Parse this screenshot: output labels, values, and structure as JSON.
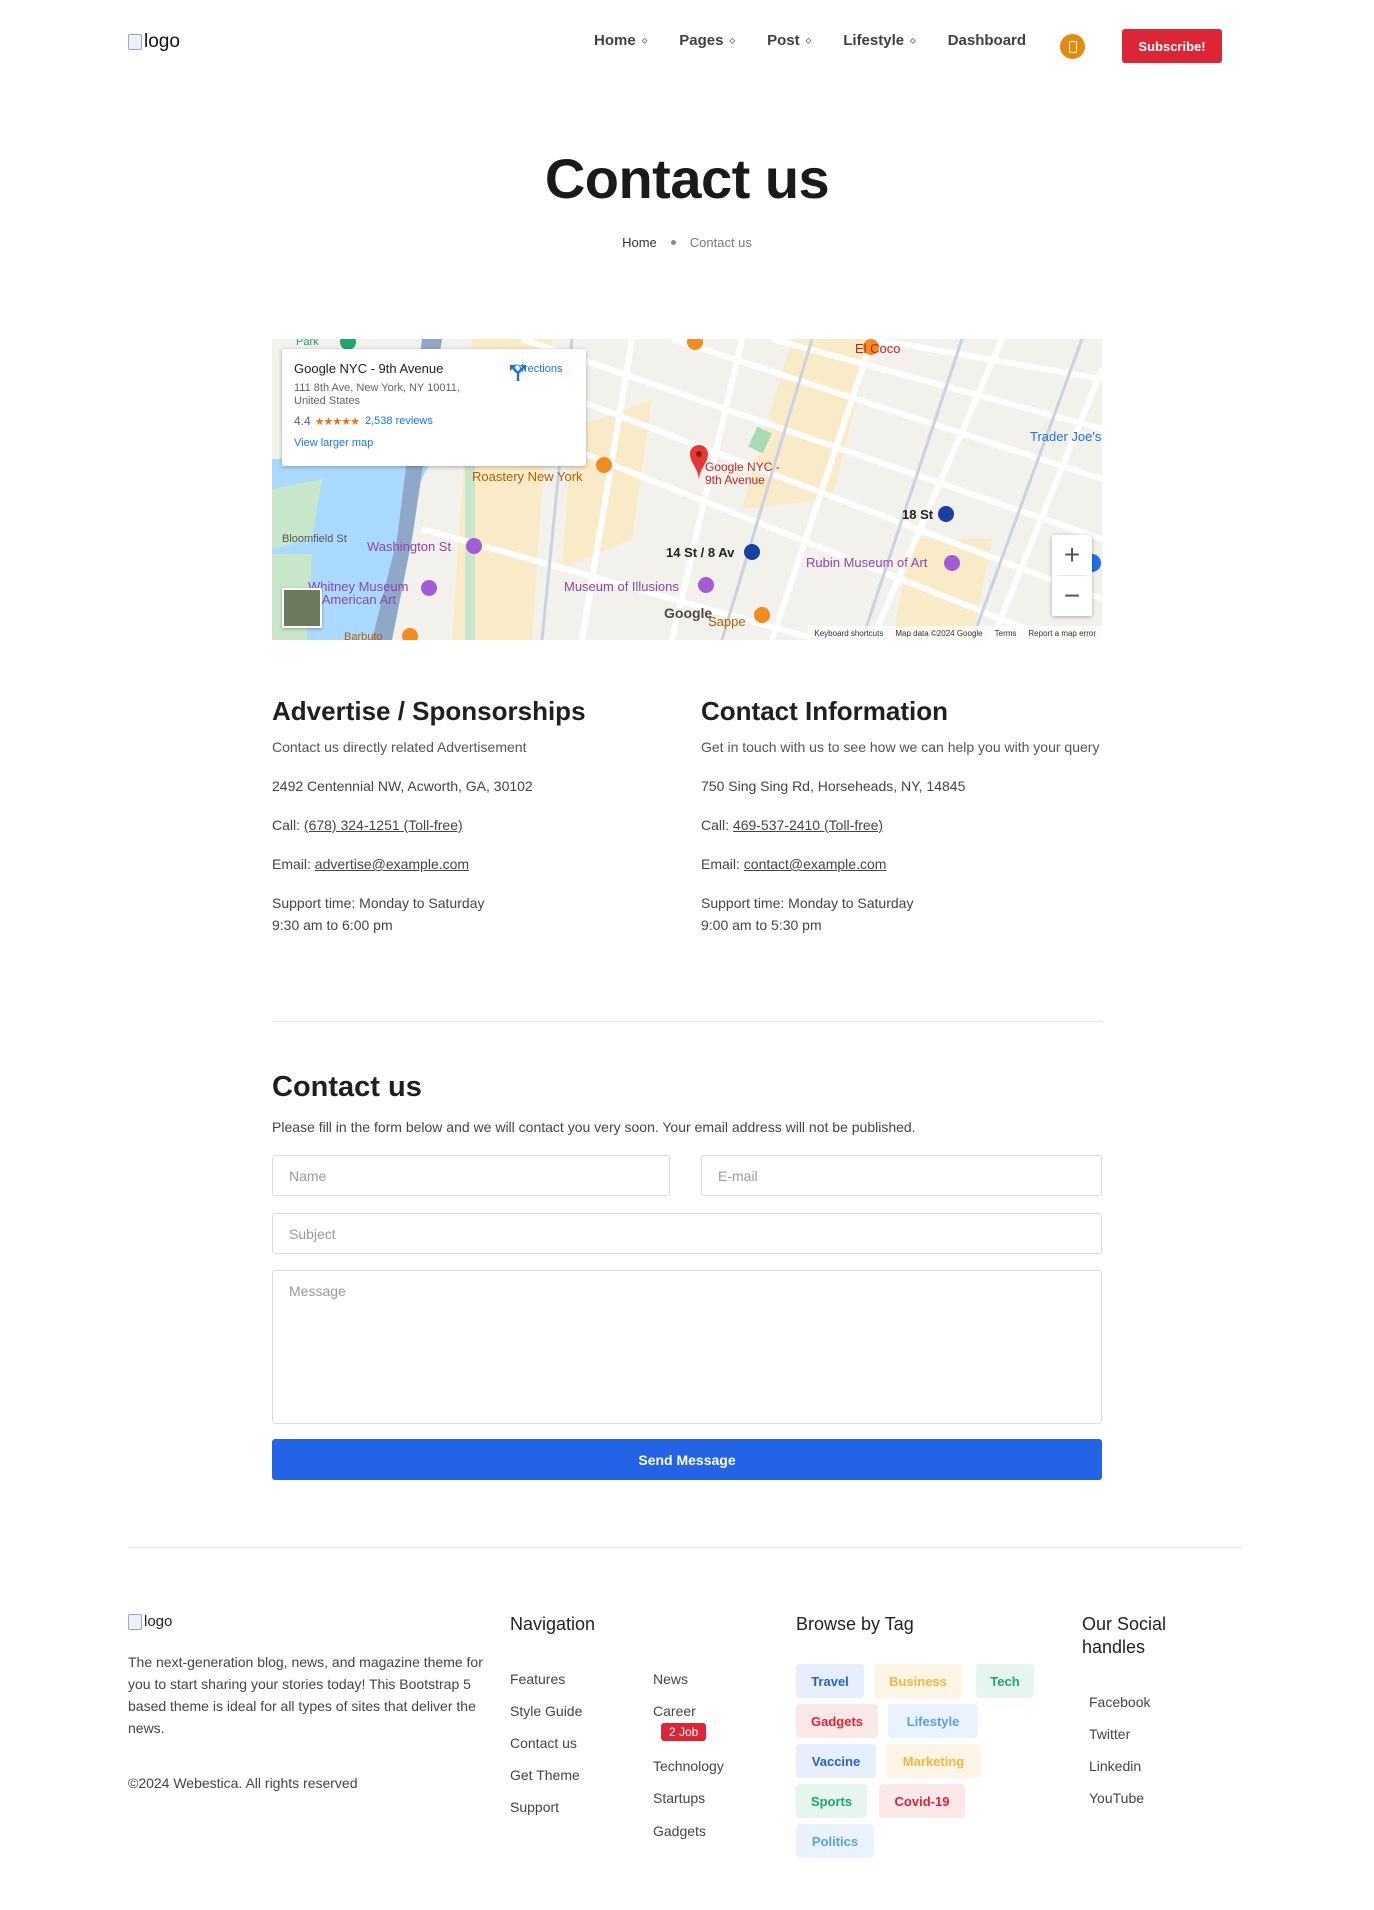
{
  "header": {
    "logo_alt": "logo",
    "nav": [
      "Home",
      "Pages",
      "Post",
      "Lifestyle",
      "Dashboard"
    ],
    "subscribe_label": "Subscribe!"
  },
  "page": {
    "title": "Contact us",
    "breadcrumb": [
      "Home",
      "Contact us"
    ]
  },
  "map": {
    "place_name": "Google NYC - 9th Avenue",
    "address": "111 8th Ave, New York, NY 10011, United States",
    "rating": "4.4",
    "stars": "★★★★★",
    "reviews": "2,538 reviews",
    "directions": "Directions",
    "larger_map": "View larger map",
    "pin_label_1": "Google NYC -",
    "pin_label_2": "9th Avenue",
    "footer": [
      "Keyboard shortcuts",
      "Map data ©2024 Google",
      "Terms",
      "Report a map error"
    ],
    "google": "Google",
    "zoom_in": "+",
    "zoom_out": "−",
    "labels": {
      "el_coco": "El Coco",
      "roastery": "Roastery New York",
      "washington": "Washington St",
      "bloomfield": "Bloomfield St",
      "whitney_1": "Whitney Museum",
      "whitney_2": "of American Art",
      "museum_illusions": "Museum of Illusions",
      "rubin": "Rubin Museum of Art",
      "trader": "Trader Joe's",
      "st14": "14 St / 8 Av",
      "st18": "18 St",
      "sappe": "Sappe",
      "barbuto": "Barbuto",
      "park": "Park"
    }
  },
  "advertise": {
    "title": "Advertise / Sponsorships",
    "intro": "Contact us directly related Advertisement",
    "address": "2492 Centennial NW, Acworth, GA, 30102",
    "call_prefix": "Call: ",
    "call": "(678) 324-1251 (Toll-free)",
    "email_prefix": "Email: ",
    "email": "advertise@example.com",
    "support_1": "Support time: Monday to Saturday",
    "support_2": "9:30 am to 6:00 pm"
  },
  "contact_info": {
    "title": "Contact Information",
    "intro": "Get in touch with us to see how we can help you with your query",
    "address": "750 Sing Sing Rd, Horseheads, NY, 14845",
    "call_prefix": "Call: ",
    "call": "469-537-2410 (Toll-free)",
    "email_prefix": "Email: ",
    "email": "contact@example.com",
    "support_1": "Support time: Monday to Saturday",
    "support_2": "9:00 am to 5:30 pm"
  },
  "form": {
    "title": "Contact us",
    "description": "Please fill in the form below and we will contact you very soon. Your email address will not be published.",
    "name_placeholder": "Name",
    "email_placeholder": "E-mail",
    "subject_placeholder": "Subject",
    "message_placeholder": "Message",
    "submit": "Send Message"
  },
  "footer": {
    "logo_alt": "logo",
    "about": "The next-generation blog, news, and magazine theme for you to start sharing your stories today! This Bootstrap 5 based theme is ideal for all types of sites that deliver the news.",
    "copyright": "©2024 Webestica. All rights reserved",
    "navigation_title": "Navigation",
    "nav_col1": [
      "Features",
      "Style Guide",
      "Contact us",
      "Get Theme",
      "Support"
    ],
    "nav_col2": [
      "News",
      "Career",
      "Technology",
      "Startups",
      "Gadgets"
    ],
    "job_badge": "2 Job",
    "tags_title": "Browse by Tag",
    "tags": [
      {
        "label": "Travel",
        "color": "#2563c9",
        "bg": "#e7effc"
      },
      {
        "label": "Business",
        "color": "#f0b640",
        "bg": "#fdf6e6"
      },
      {
        "label": "Tech",
        "color": "#1aa86c",
        "bg": "#e6f6ee"
      },
      {
        "label": "Gadgets",
        "color": "#dc2636",
        "bg": "#fbe9ea"
      },
      {
        "label": "Lifestyle",
        "color": "#5aa0e8",
        "bg": "#eaf3fd"
      },
      {
        "label": "Vaccine",
        "color": "#2563c9",
        "bg": "#e7effc"
      },
      {
        "label": "Marketing",
        "color": "#f0b640",
        "bg": "#fdf6e6"
      },
      {
        "label": "Sports",
        "color": "#1aa86c",
        "bg": "#e6f6ee"
      },
      {
        "label": "Covid-19",
        "color": "#dc2636",
        "bg": "#fbe9ea"
      },
      {
        "label": "Politics",
        "color": "#5aa0e8",
        "bg": "#eaf3fd"
      }
    ],
    "social_title": "Our Social handles",
    "social": [
      "Facebook",
      "Twitter",
      "Linkedin",
      "YouTube"
    ]
  }
}
